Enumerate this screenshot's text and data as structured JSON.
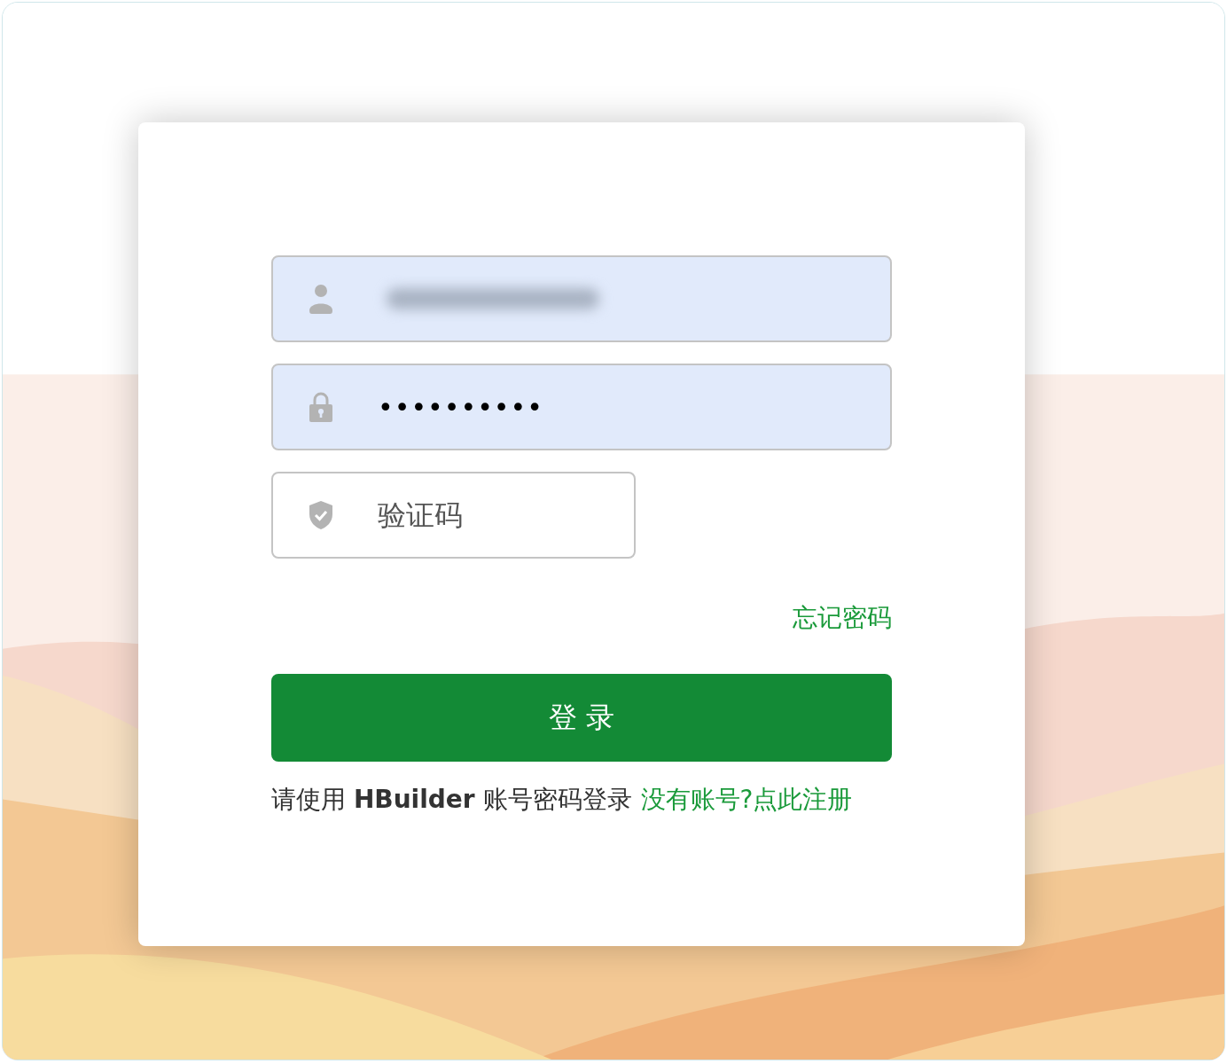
{
  "login_form": {
    "fields": [
      {
        "kind": "user",
        "filled": true,
        "blurred": true
      },
      {
        "kind": "password",
        "value": "••••••••••",
        "filled": true,
        "blurred": false
      },
      {
        "kind": "captcha",
        "placeholder": "验证码",
        "filled": false,
        "blurred": false
      }
    ],
    "forgot_link": "忘记密码",
    "login_button": "登 录",
    "hint": "请使用 **HBuilder** 账号密码登录",
    "register_link": "没有账号?点此注册"
  }
}
